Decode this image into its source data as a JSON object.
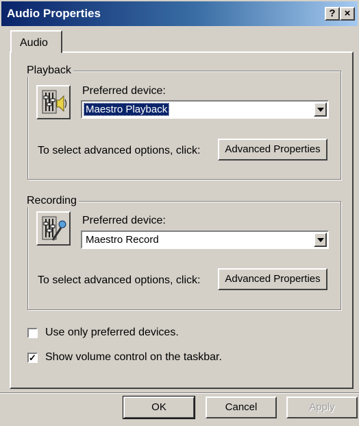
{
  "window": {
    "title": "Audio Properties",
    "help_label": "?",
    "close_label": "×"
  },
  "tabs": [
    {
      "label": "Audio"
    }
  ],
  "playback": {
    "group_label": "Playback",
    "preferred_label": "Preferred device:",
    "device": "Maestro Playback",
    "advanced_text": "To select advanced options, click:",
    "advanced_button": "Advanced Properties"
  },
  "recording": {
    "group_label": "Recording",
    "preferred_label": "Preferred device:",
    "device": "Maestro Record",
    "advanced_text": "To select advanced options, click:",
    "advanced_button": "Advanced Properties"
  },
  "options": {
    "preferred_only_label": "Use only preferred devices.",
    "preferred_only_checked": false,
    "volume_taskbar_label": "Show volume control on the taskbar.",
    "volume_taskbar_checked": true
  },
  "buttons": {
    "ok": "OK",
    "cancel": "Cancel",
    "apply": "Apply"
  },
  "icons": {
    "playback": "speaker-mixer-icon",
    "recording": "microphone-mixer-icon",
    "dropdown": "chevron-down-icon"
  }
}
